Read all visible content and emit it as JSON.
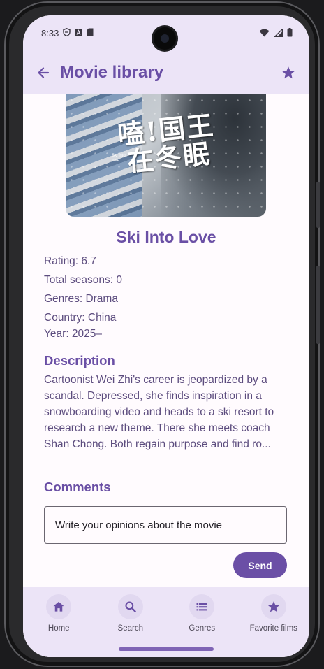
{
  "status_bar": {
    "time": "8:33",
    "left_icons": [
      "shield-icon",
      "a-box-icon",
      "sd-card-icon"
    ],
    "right_icons": [
      "wifi-icon",
      "signal-icon",
      "battery-icon"
    ]
  },
  "app_bar": {
    "title": "Movie library",
    "back_icon": "arrow-back-icon",
    "favorite_icon": "star-icon"
  },
  "movie": {
    "poster_text": "嗑!国王在冬眠",
    "poster_subtext": "Ski into love",
    "title": "Ski Into Love",
    "rating": "Rating: 6.7",
    "seasons": "Total seasons: 0",
    "genres": "Genres: Drama",
    "country": "Country: China",
    "year": "Year: 2025–"
  },
  "description": {
    "heading": "Description",
    "text": "Cartoonist Wei Zhi's career is jeopardized by a scandal. Depressed, she finds inspiration in a snowboarding video and heads to a ski resort to research a new theme. There she meets coach Shan Chong. Both regain purpose and find ro..."
  },
  "comments": {
    "heading": "Comments",
    "placeholder": "Write your opinions about the movie",
    "value": "",
    "send_label": "Send"
  },
  "bottom_nav": {
    "items": [
      {
        "label": "Home",
        "icon": "home-icon"
      },
      {
        "label": "Search",
        "icon": "search-icon"
      },
      {
        "label": "Genres",
        "icon": "list-icon"
      },
      {
        "label": "Favorite films",
        "icon": "star-icon"
      }
    ]
  },
  "colors": {
    "accent": "#6a4fa5",
    "bar_background": "#ece4f7",
    "page_background": "#fffbfe",
    "body_text": "#5c4c7e",
    "button": "#6b4fa6"
  }
}
